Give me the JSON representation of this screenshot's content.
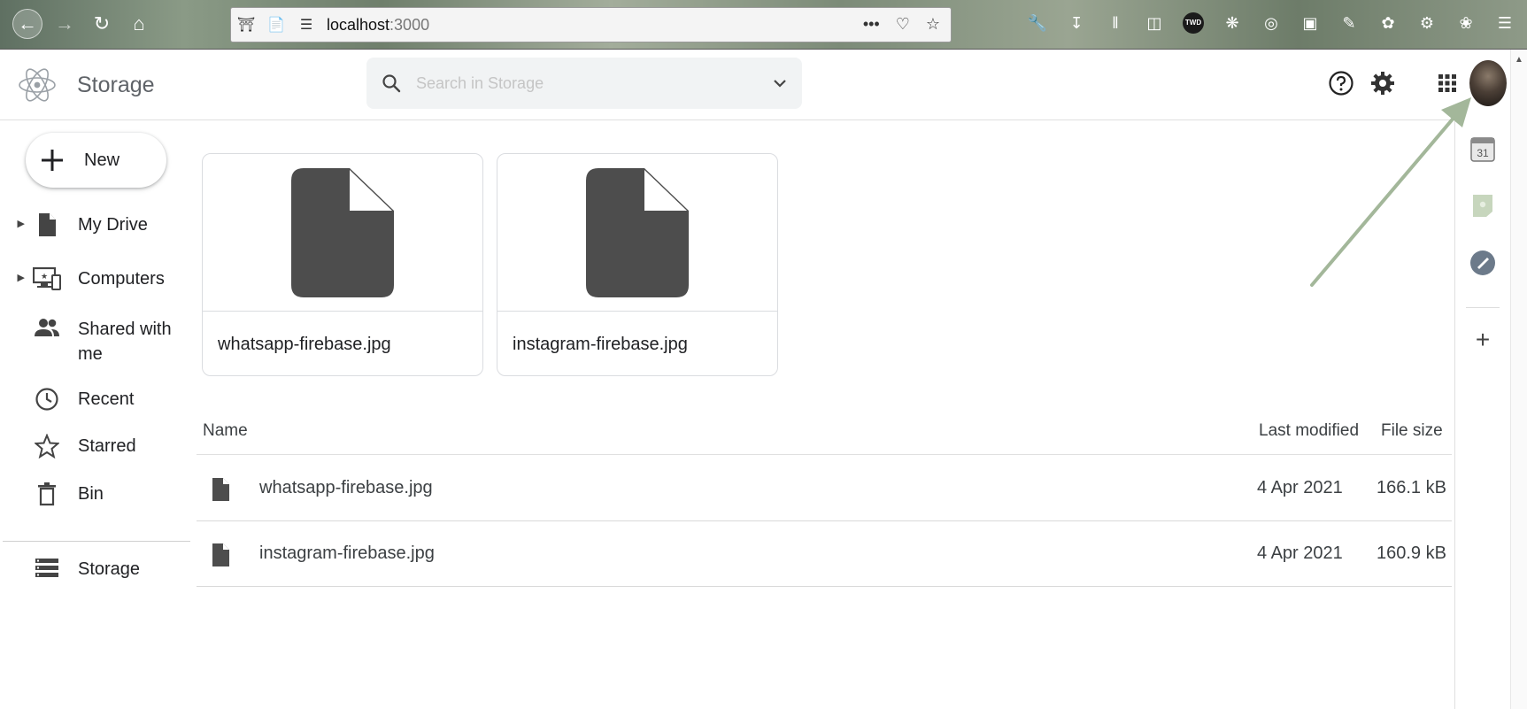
{
  "browser": {
    "url_host": "localhost",
    "url_port": ":3000",
    "menu_dots": "•••",
    "extension_badge": "TWD"
  },
  "app": {
    "title": "Storage"
  },
  "search": {
    "placeholder": "Search in Storage"
  },
  "sidebar": {
    "new_label": "New",
    "items": [
      {
        "label": "My Drive",
        "icon": "file-icon",
        "expandable": true
      },
      {
        "label": "Computers",
        "icon": "computers-icon",
        "expandable": true
      },
      {
        "label": "Shared with me",
        "icon": "people-icon",
        "expandable": false
      },
      {
        "label": "Recent",
        "icon": "clock-icon",
        "expandable": false
      },
      {
        "label": "Starred",
        "icon": "star-icon",
        "expandable": false
      },
      {
        "label": "Bin",
        "icon": "trash-icon",
        "expandable": false
      },
      {
        "label": "Storage",
        "icon": "storage-icon",
        "expandable": false
      }
    ]
  },
  "cards": [
    {
      "name": "whatsapp-firebase.jpg"
    },
    {
      "name": "instagram-firebase.jpg"
    }
  ],
  "file_list": {
    "columns": {
      "name": "Name",
      "modified": "Last modified",
      "size": "File size"
    },
    "rows": [
      {
        "name": "whatsapp-firebase.jpg",
        "modified": "4 Apr 2021",
        "size": "166.1 kB"
      },
      {
        "name": "instagram-firebase.jpg",
        "modified": "4 Apr 2021",
        "size": "160.9 kB"
      }
    ]
  },
  "side_panel": {
    "calendar_day": "31"
  },
  "colors": {
    "file_icon": "#4d4d4d",
    "search_bg": "#f1f3f4",
    "annotation_arrow": "#a3b79a"
  }
}
